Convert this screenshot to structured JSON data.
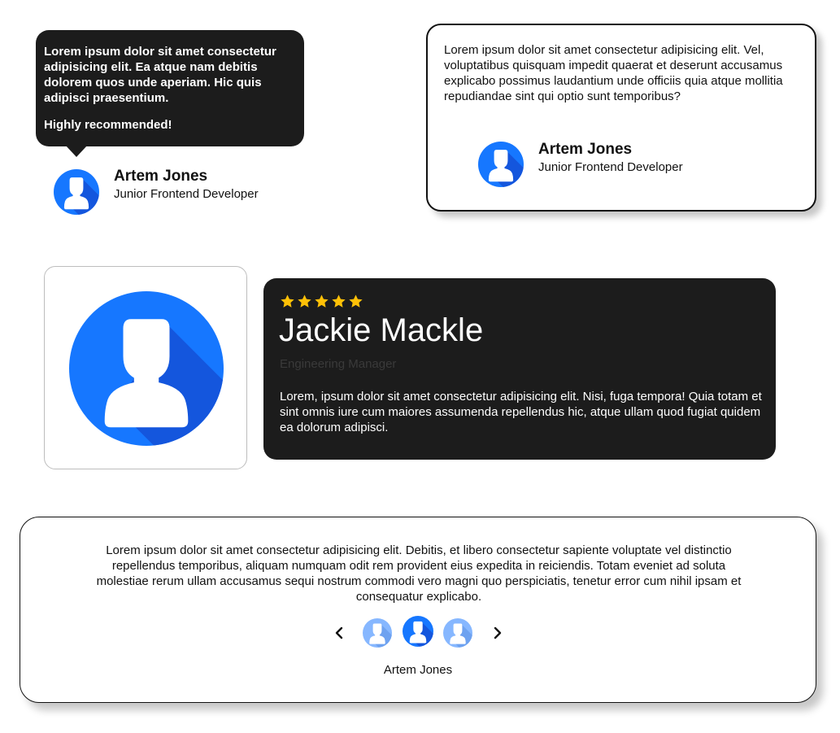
{
  "colors": {
    "dark_card": "#1c1c1c",
    "avatar_blue": "#1677ff",
    "avatar_shadow": "#1456dd",
    "avatar_light": "#7fb3ff",
    "star": "#ffc107"
  },
  "icons": {
    "avatar": "user-avatar-icon",
    "star": "star-icon",
    "prev": "chevron-left-icon",
    "next": "chevron-right-icon"
  },
  "card1": {
    "quote": "Lorem ipsum dolor sit amet consectetur adipisicing elit. Ea atque nam debitis dolorem quos unde aperiam. Hic quis adipisci praesentium.",
    "highlight": "Highly recommended!",
    "name": "Artem Jones",
    "role": "Junior Frontend Developer"
  },
  "card2": {
    "quote": "Lorem ipsum dolor sit amet consectetur adipisicing elit. Vel, voluptatibus quisquam impedit quaerat et deserunt accusamus explicabo possimus laudantium unde officiis quia atque mollitia repudiandae sint qui optio sunt temporibus?",
    "name": "Artem Jones",
    "role": "Junior Frontend Developer"
  },
  "card3": {
    "rating": 5,
    "rating_max": 5,
    "name": "Jackie Mackle",
    "role": "Engineering Manager",
    "text": "Lorem, ipsum dolor sit amet consectetur adipisicing elit. Nisi, fuga tempora! Quia totam et sint omnis iure cum maiores assumenda repellendus hic, atque ullam quod fugiat quidem ea dolorum adipisci."
  },
  "card4": {
    "text": "Lorem ipsum dolor sit amet consectetur adipisicing elit. Debitis, et libero consectetur sapiente voluptate vel distinctio repellendus temporibus, aliquam numquam odit rem provident eius expedita in reiciendis. Totam eveniet ad soluta molestiae rerum ullam accusamus sequi nostrum commodi vero magni quo perspiciatis, tenetur error cum nihil ipsam et consequatur explicabo.",
    "active_index": 2,
    "dot_count": 3,
    "name": "Artem Jones"
  }
}
